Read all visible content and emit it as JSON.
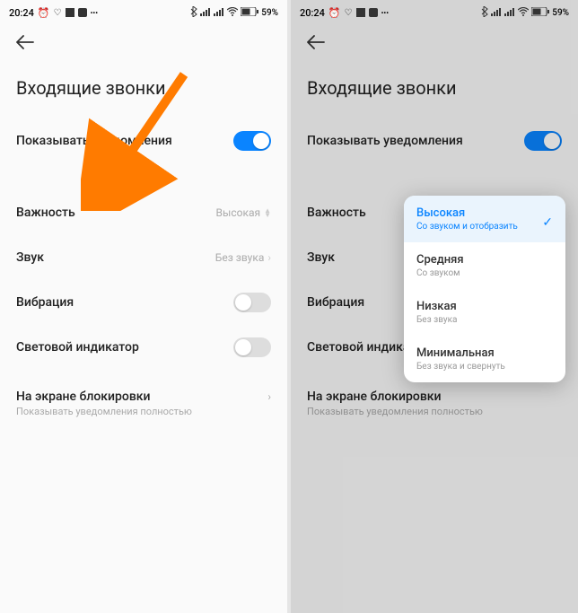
{
  "statusbar": {
    "time": "20:24",
    "battery": "59%"
  },
  "page": {
    "title": "Входящие звонки"
  },
  "rows": {
    "show_notifications": "Показывать уведомления",
    "importance": "Важность",
    "importance_value": "Высокая",
    "sound": "Звук",
    "sound_value": "Без звука",
    "vibration": "Вибрация",
    "light_indicator": "Световой индикатор",
    "lock_screen": "На экране блокировки",
    "lock_screen_sub": "Показывать уведомления полностью"
  },
  "popup": {
    "options": [
      {
        "title": "Высокая",
        "sub": "Со звуком и отобразить",
        "selected": true
      },
      {
        "title": "Средняя",
        "sub": "Со звуком",
        "selected": false
      },
      {
        "title": "Низкая",
        "sub": "Без звука",
        "selected": false
      },
      {
        "title": "Минимальная",
        "sub": "Без звука и свернуть",
        "selected": false
      }
    ]
  }
}
